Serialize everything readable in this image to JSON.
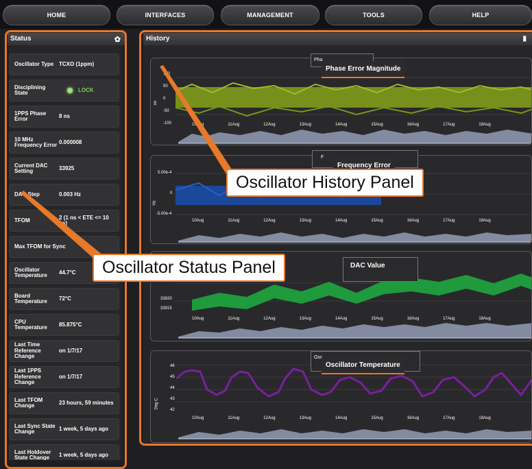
{
  "nav": [
    "HOME",
    "INTERFACES",
    "MANAGEMENT",
    "TOOLS",
    "HELP"
  ],
  "status_panel": {
    "title": "Status",
    "rows": [
      {
        "label": "Oscillator Type",
        "value": "TCXO (1ppm)"
      },
      {
        "label": "Disciplining State",
        "value": "LOCK"
      },
      {
        "label": "1PPS Phase Error",
        "value": "8 ns"
      },
      {
        "label": "10 MHz Frequency Error",
        "value": "0.000008"
      },
      {
        "label": "Current DAC Setting",
        "value": "33925"
      },
      {
        "label": "DAC Step",
        "value": "0.003 Hz"
      },
      {
        "label": "TFOM",
        "value": "2 (1 ns < ETE <= 10 ns)"
      },
      {
        "label": "Max TFOM for Sync",
        "value": ""
      },
      {
        "label": "Oscillator Temperature",
        "value": "44.7°C"
      },
      {
        "label": "Board Temperature",
        "value": "72°C"
      },
      {
        "label": "CPU Temperature",
        "value": "85.875°C"
      },
      {
        "label": "Last Time Reference Change",
        "value": "on 1/7/17"
      },
      {
        "label": "Last 1PPS Reference Change",
        "value": "on 1/7/17"
      },
      {
        "label": "Last TFOM Change",
        "value": "23 hours, 59 minutes"
      },
      {
        "label": "Last Sync State Change",
        "value": "1 week, 5 days ago"
      },
      {
        "label": "Last Holdover State Change",
        "value": "1 week, 5 days ago"
      }
    ]
  },
  "history_panel": {
    "title": "History",
    "charts": [
      {
        "title": "Phase Error Magnitude",
        "peek": "Pha",
        "ylabel": "ns",
        "yticks": [
          "100",
          "50",
          "0",
          "-50",
          "-100"
        ],
        "color": "#8aa51c"
      },
      {
        "title": "Frequency Error",
        "peek": "F",
        "ylabel": "Hz",
        "yticks": [
          "5.00e-4",
          "0",
          "-5.00e-4"
        ],
        "color": "#1d4fa8"
      },
      {
        "title": "DAC Value",
        "peek": "",
        "ylabel": "",
        "yticks": [
          "33920",
          "33915"
        ],
        "color": "#1f9a3c"
      },
      {
        "title": "Oscillator Temperature",
        "peek": "Osc",
        "ylabel": "Deg C",
        "yticks": [
          "46",
          "45",
          "44",
          "43",
          "42"
        ],
        "color": "#7a1fa0"
      }
    ],
    "xticks": [
      "10Aug",
      "11Aug",
      "12Aug",
      "13Aug",
      "14Aug",
      "15Aug",
      "16Aug",
      "17Aug",
      "18Aug"
    ]
  },
  "annotations": {
    "history": "Oscillator History Panel",
    "status": "Oscillator Status Panel"
  },
  "icons": {
    "status_settings": "gear-icon",
    "history_delete": "trash-icon"
  },
  "colors": {
    "accent": "#e8782a",
    "lock": "#7ed05a"
  }
}
